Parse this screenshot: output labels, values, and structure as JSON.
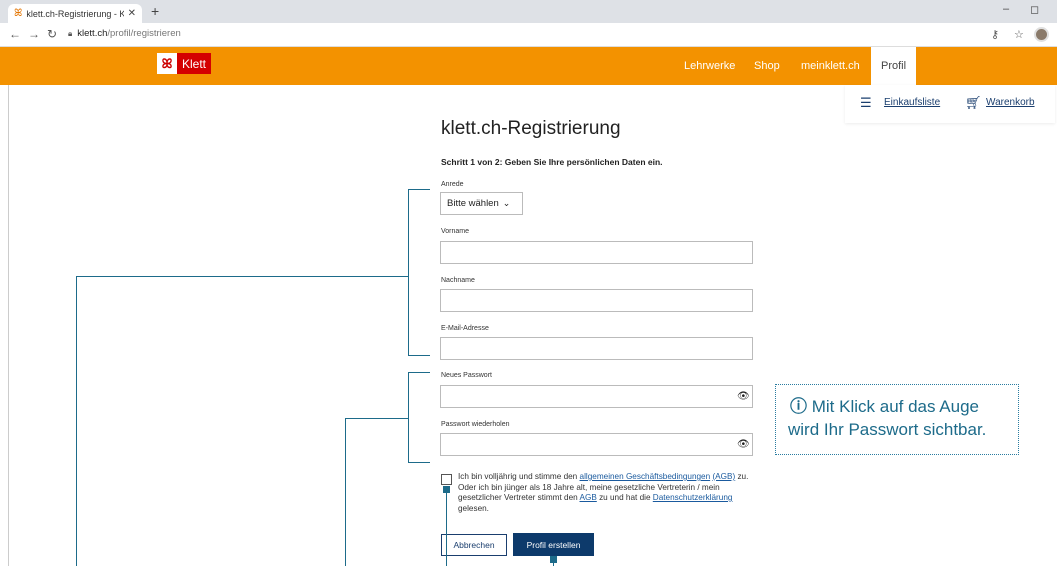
{
  "browser": {
    "tab_title": "klett.ch-Registrierung - Klett und",
    "tab_close": "✕",
    "new_tab": "+",
    "url_host": "klett.ch",
    "url_path": "/profil/registrieren",
    "minimize": "–",
    "restore": "◻"
  },
  "site": {
    "logo_text": "Klett",
    "brand_color": "#f39200",
    "menu": [
      "Lehrwerke",
      "Shop",
      "meinklett.ch",
      "Profil"
    ],
    "utility": {
      "list_label": "Einkaufsliste",
      "cart_label": "Warenkorb"
    }
  },
  "form": {
    "title": "klett.ch-Registrierung",
    "step": "Schritt 1 von 2: Geben Sie Ihre persönlichen Daten ein.",
    "salutation_label": "Anrede",
    "salutation_value": "Bitte wählen",
    "firstname_label": "Vorname",
    "lastname_label": "Nachname",
    "email_label": "E-Mail-Adresse",
    "password_label": "Neues Passwort",
    "password_repeat_label": "Passwort wiederholen",
    "terms": {
      "t1": "Ich bin volljährig und stimme den ",
      "l1": "allgemeinen Geschäftsbedingungen",
      "t2": " ",
      "l2": "(AGB)",
      "t3": " zu. Oder ich bin jünger als 18 Jahre alt, meine gesetzliche Vertreterin / mein gesetzlicher Vertreter stimmt den ",
      "l3": "AGB",
      "t4": " zu und hat die ",
      "l4": "Datenschutzerklärung",
      "t5": " gelesen."
    },
    "cancel_label": "Abbrechen",
    "submit_label": "Profil erstellen"
  },
  "annotation": {
    "icon": "ⓘ",
    "line1": "Mit Klick auf das Auge",
    "line2": "wird Ihr Passwort sichtbar.",
    "color": "#1d6b8a"
  }
}
